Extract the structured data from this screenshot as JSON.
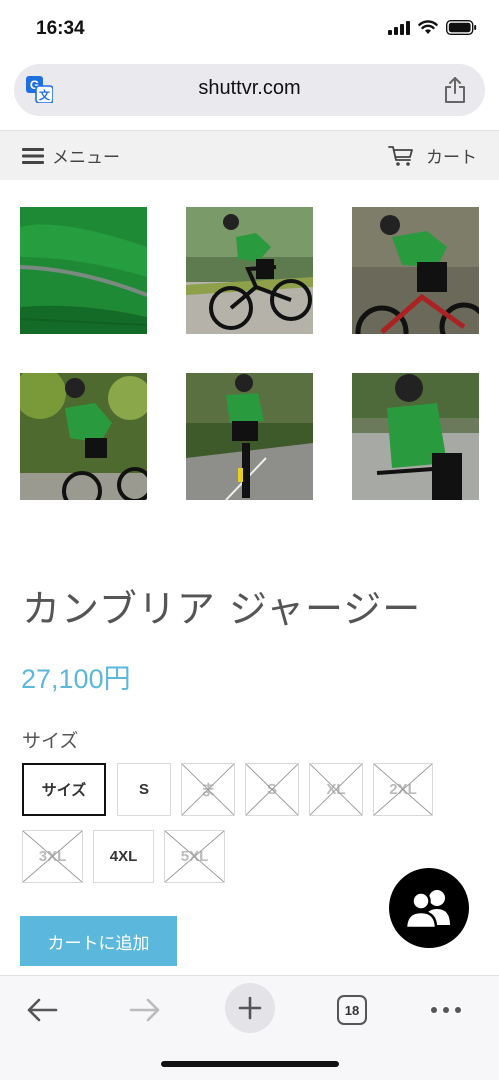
{
  "status_bar": {
    "time": "16:34"
  },
  "browser": {
    "url": "shuttvr.com",
    "tab_count": "18"
  },
  "header": {
    "menu_label": "メニュー",
    "cart_label": "カート"
  },
  "gallery": {
    "images": [
      {
        "name": "jersey-fabric-closeup"
      },
      {
        "name": "cyclist-riding-side"
      },
      {
        "name": "cyclist-riding-hills"
      },
      {
        "name": "cyclist-riding-trees"
      },
      {
        "name": "cyclist-riding-road"
      },
      {
        "name": "cyclist-closeup"
      }
    ]
  },
  "product": {
    "title": "カンブリア ジャージー",
    "price": "27,100円",
    "size_label": "サイズ",
    "sizes": [
      {
        "label": "サイズ",
        "state": "selected"
      },
      {
        "label": "S",
        "state": "available"
      },
      {
        "label": "ま",
        "state": "unavailable"
      },
      {
        "label": "S",
        "state": "unavailable"
      },
      {
        "label": "XL",
        "state": "unavailable"
      },
      {
        "label": "2XL",
        "state": "unavailable"
      },
      {
        "label": "3XL",
        "state": "unavailable"
      },
      {
        "label": "4XL",
        "state": "available"
      },
      {
        "label": "5XL",
        "state": "unavailable"
      }
    ],
    "add_to_cart_label": "カートに追加"
  },
  "colors": {
    "accent": "#5bb8dc",
    "header_bg": "#f1f1f1",
    "jersey_green": "#2a8a3a"
  }
}
